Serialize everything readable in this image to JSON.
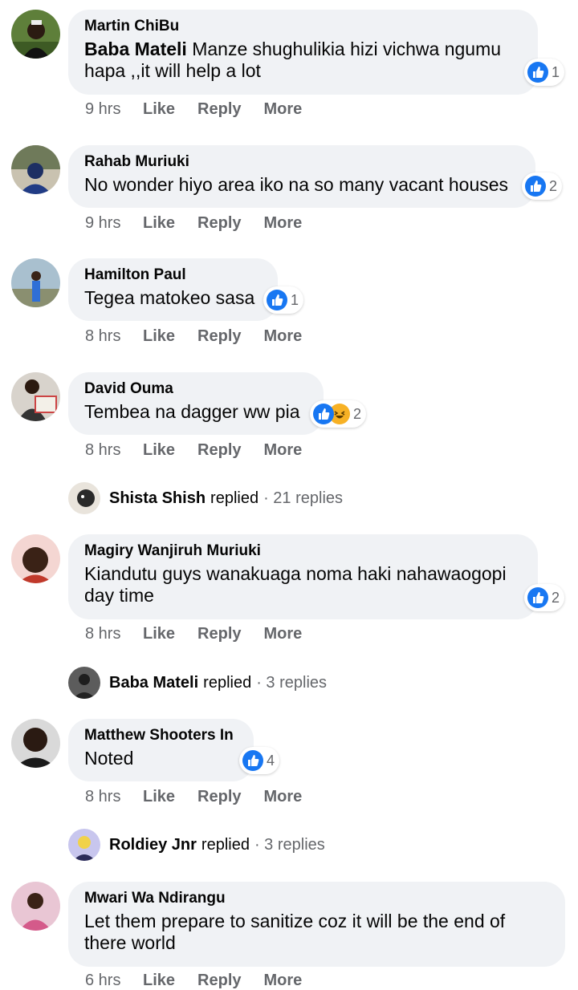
{
  "colors": {
    "bubble": "#f0f2f5",
    "like": "#1877f2",
    "meta": "#65676b",
    "text": "#050505"
  },
  "comments": [
    {
      "author": "Martin ChiBu",
      "mention": "Baba Mateli",
      "text": " Manze shughulikia hizi vichwa ngumu hapa ,,it will help a lot",
      "reactions": "1",
      "time": "9 hrs",
      "like": "Like",
      "reply": "Reply",
      "more": "More"
    },
    {
      "author": "Rahab Muriuki",
      "mention": "",
      "text": "No wonder hiyo area iko na so many vacant houses",
      "reactions": "2",
      "time": "9 hrs",
      "like": "Like",
      "reply": "Reply",
      "more": "More"
    },
    {
      "author": "Hamilton Paul",
      "mention": "",
      "text": "Tegea matokeo sasa",
      "reactions": "1",
      "time": "8 hrs",
      "like": "Like",
      "reply": "Reply",
      "more": "More"
    },
    {
      "author": "David Ouma",
      "mention": "",
      "text": "Tembea na dagger ww pia",
      "reactions": "2",
      "time": "8 hrs",
      "like": "Like",
      "reply": "Reply",
      "more": "More"
    },
    {
      "author": "Magiry Wanjiruh Muriuki",
      "mention": "",
      "text": "Kiandutu guys wanakuaga noma haki nahawaogopi day time",
      "reactions": "2",
      "time": "8 hrs",
      "like": "Like",
      "reply": "Reply",
      "more": "More"
    },
    {
      "author": "Matthew Shooters In",
      "mention": "",
      "text": "Noted",
      "reactions": "4",
      "time": "8 hrs",
      "like": "Like",
      "reply": "Reply",
      "more": "More"
    },
    {
      "author": "Mwari Wa Ndirangu",
      "mention": "",
      "text": "Let them prepare to sanitize coz it will be the end of there world",
      "reactions": "",
      "time": "6 hrs",
      "like": "Like",
      "reply": "Reply",
      "more": "More"
    }
  ],
  "replies": [
    {
      "name": "Shista Shish",
      "word": "replied",
      "count": "· 21 replies"
    },
    {
      "name": "Baba Mateli",
      "word": "replied",
      "count": "· 3 replies"
    },
    {
      "name": "Roldiey Jnr",
      "word": "replied",
      "count": "· 3 replies"
    }
  ]
}
